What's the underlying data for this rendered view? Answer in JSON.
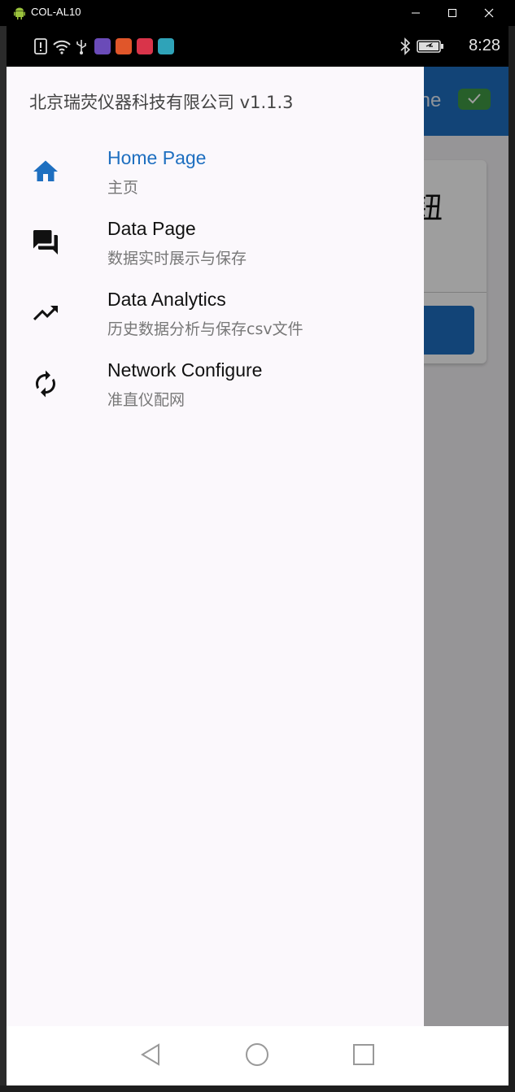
{
  "window": {
    "title": "COL-AL10",
    "app_icon": "android-icon",
    "controls": [
      "minimize-icon",
      "maximize-icon",
      "close-icon"
    ]
  },
  "status_bar": {
    "time": "8:28",
    "left_icons": [
      "alert-icon",
      "wifi-icon",
      "usb-icon",
      "app-icon-purple",
      "app-icon-orange",
      "app-icon-red",
      "app-icon-teal"
    ],
    "right_icons": [
      "bluetooth-icon",
      "battery-icon"
    ]
  },
  "background_page": {
    "online_label": "line",
    "card_title_fragment": "钮",
    "colors": {
      "appbar": "#1e6fc0",
      "online_badge": "#3f9a44"
    }
  },
  "drawer": {
    "header": "北京瑞荧仪器科技有限公司 v1.1.3",
    "items": [
      {
        "title": "Home Page",
        "subtitle": "主页",
        "icon": "home-icon",
        "active": true
      },
      {
        "title": "Data Page",
        "subtitle": "数据实时展示与保存",
        "icon": "forum-icon",
        "active": false
      },
      {
        "title": "Data Analytics",
        "subtitle": "历史数据分析与保存csv文件",
        "icon": "trending-up-icon",
        "active": false
      },
      {
        "title": "Network Configure",
        "subtitle": "准直仪配网",
        "icon": "refresh-icon",
        "active": false
      }
    ],
    "accent_color": "#1e6fc0"
  },
  "nav_bar": {
    "buttons": [
      "back-icon",
      "home-circle-icon",
      "recents-icon"
    ]
  }
}
